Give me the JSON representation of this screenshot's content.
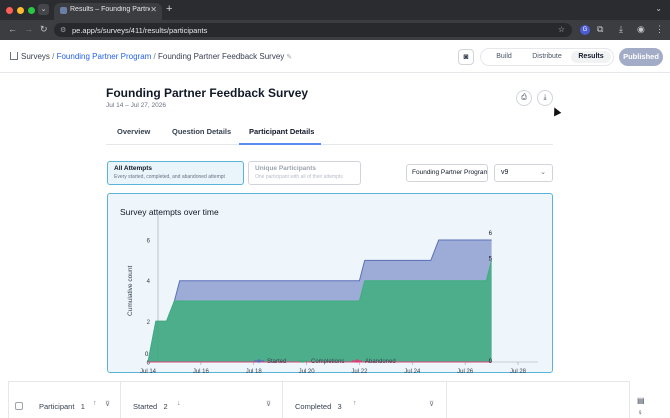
{
  "browser": {
    "tab_title": "Results – Founding Partner Fe",
    "url": "pe.app/s/surveys/411/results/participants",
    "profile_letter": "G",
    "traffic_colors": [
      "#ff5f57",
      "#febc2e",
      "#28c840"
    ]
  },
  "header": {
    "breadcrumbs": {
      "surveys": "Surveys",
      "program": "Founding Partner Program",
      "survey": "Founding Partner Feedback Survey"
    },
    "modes": [
      "Build",
      "Distribute",
      "Results"
    ],
    "active_mode": "Results",
    "status": "Published"
  },
  "page": {
    "title": "Founding Partner Feedback Survey",
    "dates": "Jul 14 – Jul 27, 2026",
    "tabs": [
      "Overview",
      "Question Details",
      "Participant Details"
    ],
    "active_tab": "Participant Details"
  },
  "filters": {
    "all_attempts": {
      "title": "All Attempts",
      "subtitle": "Every started, completed, and abandoned attempt"
    },
    "unique_participants": {
      "title": "Unique Participants",
      "subtitle": "One participant with all of their attempts"
    },
    "program_select": "Founding Partner Program",
    "version_select": "v9"
  },
  "chart_data": {
    "type": "area",
    "title": "Survey attempts over time",
    "ylabel": "Cumulative count",
    "xlabel": "",
    "x_ticks": [
      "Jul 14",
      "Jul 16",
      "Jul 18",
      "Jul 20",
      "Jul 22",
      "Jul 24",
      "Jul 26",
      "Jul 28"
    ],
    "y_ticks": [
      0,
      2,
      4,
      6
    ],
    "ylim": [
      0,
      7
    ],
    "series": [
      {
        "name": "Started",
        "color": "#5a6fb8",
        "points": [
          [
            "2026-07-14",
            0
          ],
          [
            "2026-07-14.3",
            2
          ],
          [
            "2026-07-14.7",
            2
          ],
          [
            "2026-07-15",
            3
          ],
          [
            "2026-07-15.2",
            4
          ],
          [
            "2026-07-22",
            4
          ],
          [
            "2026-07-22.2",
            5
          ],
          [
            "2026-07-24.7",
            5
          ],
          [
            "2026-07-25",
            6
          ],
          [
            "2026-07-27",
            6
          ]
        ],
        "end_label": "6"
      },
      {
        "name": "Completions",
        "color": "#3fae7e",
        "points": [
          [
            "2026-07-14",
            0
          ],
          [
            "2026-07-14.3",
            2
          ],
          [
            "2026-07-14.7",
            2
          ],
          [
            "2026-07-15",
            3
          ],
          [
            "2026-07-22",
            3
          ],
          [
            "2026-07-22.2",
            4
          ],
          [
            "2026-07-26.8",
            4
          ],
          [
            "2026-07-27",
            5
          ]
        ],
        "end_label": "5"
      },
      {
        "name": "Abandoned",
        "color": "#d8447a",
        "points": [
          [
            "2026-07-14",
            0
          ],
          [
            "2026-07-27",
            0
          ]
        ],
        "end_label": "0"
      }
    ],
    "start_label": "0",
    "legend": "bottom"
  },
  "table": {
    "columns": [
      {
        "label": "Participant",
        "count": "1"
      },
      {
        "label": "Started",
        "count": "2"
      },
      {
        "label": "Completed",
        "count": "3"
      }
    ]
  }
}
